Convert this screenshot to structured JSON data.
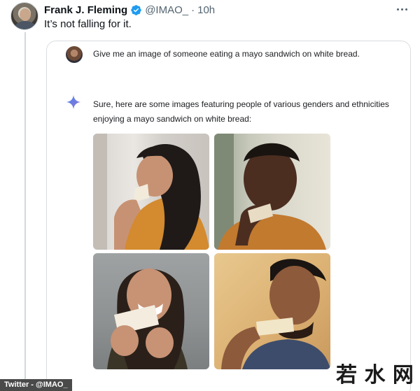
{
  "tweet": {
    "author_name": "Frank J. Fleming",
    "author_handle": "@IMAO_",
    "separator": "·",
    "time": "10h",
    "text": "It’s not falling for it.",
    "verified_icon": "verified-badge-icon",
    "more_icon": "more-horizontal-icon"
  },
  "ai_chat": {
    "prompt": "Give me an image of someone eating a mayo sandwich on white bread.",
    "response_icon": "gemini-sparkle-icon",
    "response": "Sure, here are some images featuring people of various genders and ethnicities enjoying a mayo sandwich on white bread:"
  },
  "footer": {
    "credit": "Twitter - @IMAO_",
    "watermark": "若 水 网"
  },
  "colors": {
    "verified_blue": "#1d9bf0",
    "sparkle_blue": "#4285f4",
    "secondary_text": "#536471",
    "card_border": "#dadce0"
  }
}
